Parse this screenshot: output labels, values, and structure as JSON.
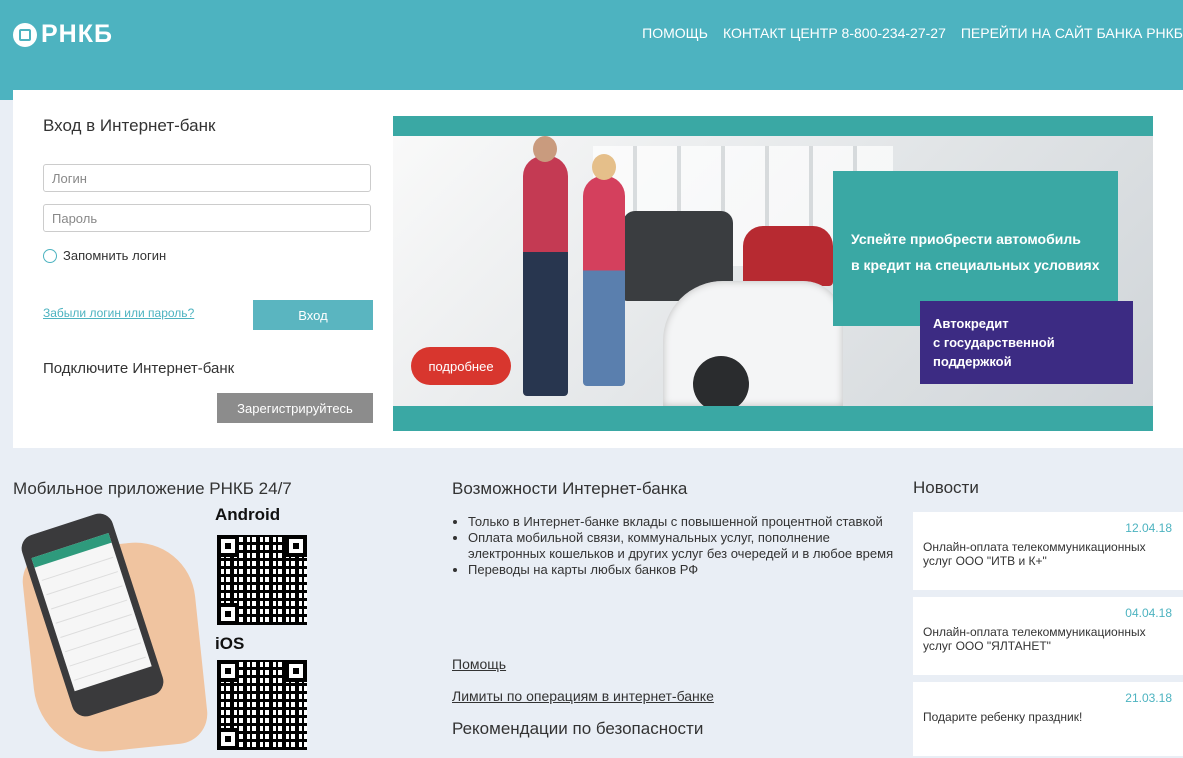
{
  "header": {
    "logo": "РНКБ",
    "nav": [
      "ПОМОЩЬ",
      "КОНТАКТ ЦЕНТР 8-800-234-27-27",
      "ПЕРЕЙТИ НА САЙТ БАНКА РНКБ"
    ]
  },
  "login": {
    "title": "Вход в Интернет-банк",
    "login_placeholder": "Логин",
    "password_placeholder": "Пароль",
    "remember": "Запомнить логин",
    "forgot": "Забыли логин или пароль?",
    "submit": "Вход",
    "connect_title": "Подключите Интернет-банк",
    "register": "Зарегистрируйтесь"
  },
  "banner": {
    "headline_1": "Успейте приобрести автомобиль",
    "headline_2": "в кредит на специальных условиях",
    "promo_1": "Автокредит",
    "promo_2": "с государственной",
    "promo_3": "поддержкой",
    "more": "подробнее"
  },
  "mobile": {
    "title": "Мобильное приложение РНКБ 24/7",
    "android": "Android",
    "ios": "iOS"
  },
  "features": {
    "title": "Возможности Интернет-банка",
    "items": [
      "Только в Интернет-банке вклады с повышенной процентной ставкой",
      "Оплата мобильной связи, коммунальных услуг, пополнение электронных кошельков и других услуг без очередей и в любое время",
      "Переводы на карты любых банков РФ"
    ],
    "help_link": "Помощь",
    "limits_link": "Лимиты по операциям в интернет-банке",
    "security_title": "Рекомендации по безопасности"
  },
  "news": {
    "title": "Новости",
    "items": [
      {
        "date": "12.04.18",
        "text": "Онлайн-оплата телекоммуникационных услуг ООО \"ИТВ и К+\""
      },
      {
        "date": "04.04.18",
        "text": "Онлайн-оплата телекоммуникационных услуг ООО \"ЯЛТАНЕТ\""
      },
      {
        "date": "21.03.18",
        "text": "Подарите ребенку праздник!"
      }
    ]
  },
  "colors": {
    "brand_teal": "#4db3c0",
    "banner_teal": "#3aa8a4",
    "promo_purple": "#3c2b83",
    "more_red": "#d8362e"
  }
}
